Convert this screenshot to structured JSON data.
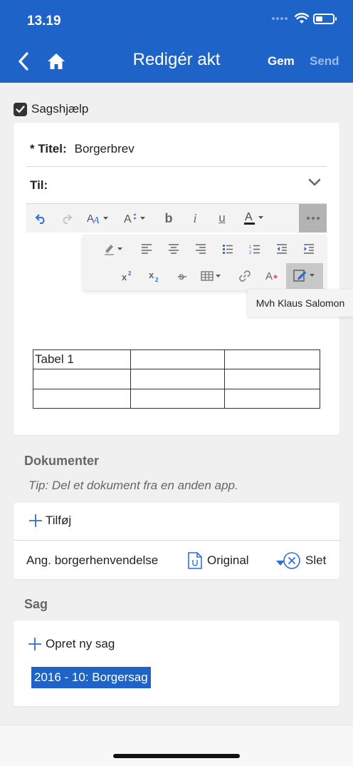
{
  "status_bar": {
    "time": "13.19"
  },
  "nav": {
    "title": "Redigér akt",
    "save_label": "Gem",
    "send_label": "Send"
  },
  "sagshjaelp": {
    "label": "Sagshjælp",
    "checked": true
  },
  "editor": {
    "title_label": "* Titel:",
    "title_value": "Borgerbrev",
    "to_label": "Til:",
    "tooltip": "Mvh Klaus Salomon",
    "table": [
      [
        "Tabel 1",
        "",
        ""
      ],
      [
        "",
        "",
        ""
      ],
      [
        "",
        "",
        ""
      ]
    ]
  },
  "documents": {
    "heading": "Dokumenter",
    "tip": "Tip: Del et dokument fra en anden app.",
    "add_label": "Tilføj",
    "items": [
      {
        "name": "Ang. borgerhenvendelse",
        "version": "Original",
        "delete_label": "Slet"
      }
    ]
  },
  "sag": {
    "heading": "Sag",
    "new_label": "Opret ny sag",
    "selected": "2016 - 10: Borgersag"
  },
  "colors": {
    "accent": "#1e64c8",
    "disabled": "#9bbbe8"
  }
}
